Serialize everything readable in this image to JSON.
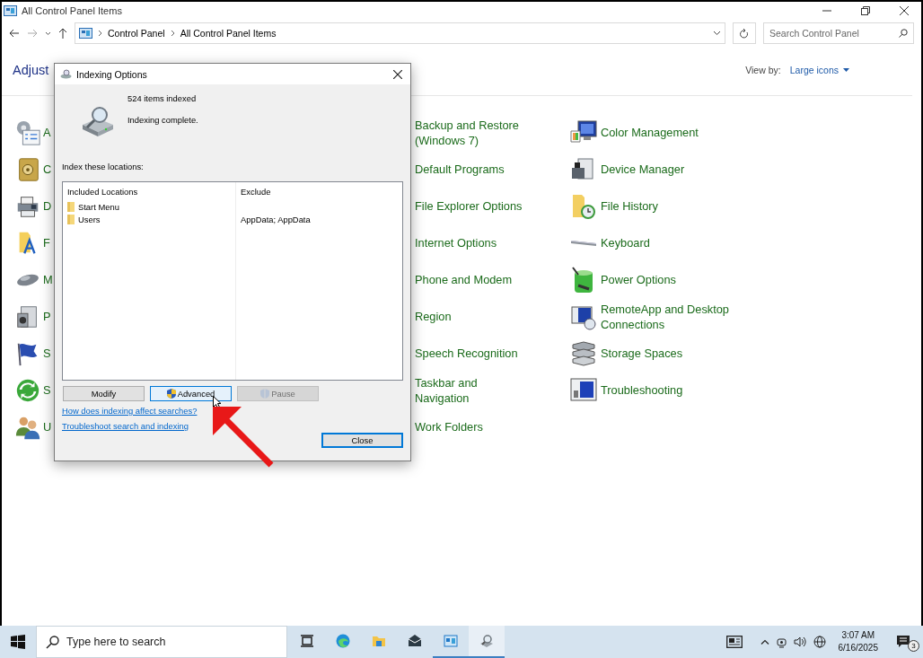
{
  "window": {
    "title": "All Control Panel Items",
    "path": [
      "Control Panel",
      "All Control Panel Items"
    ],
    "search": {
      "placeholder": "Search Control Panel"
    }
  },
  "header": {
    "title": "Adjust",
    "view_by_label": "View by:",
    "view_by_value": "Large icons"
  },
  "columns": [
    {
      "items": [
        {
          "label": "A"
        },
        {
          "label": "C"
        },
        {
          "label": "D"
        },
        {
          "label": "F"
        },
        {
          "label": "M"
        },
        {
          "label": "P"
        },
        {
          "label": "S"
        },
        {
          "label": "S"
        },
        {
          "label": "U"
        }
      ]
    },
    {
      "items": [
        {
          "label": "Backup and Restore (Windows 7)"
        },
        {
          "label": "Default Programs"
        },
        {
          "label": "File Explorer Options"
        },
        {
          "label": "Internet Options"
        },
        {
          "label": "Phone and Modem"
        },
        {
          "label": "Region"
        },
        {
          "label": "Speech Recognition"
        },
        {
          "label": "Taskbar and Navigation"
        },
        {
          "label": "Work Folders"
        }
      ]
    },
    {
      "items": [
        {
          "label": "Color Management"
        },
        {
          "label": "Device Manager"
        },
        {
          "label": "File History"
        },
        {
          "label": "Keyboard"
        },
        {
          "label": "Power Options"
        },
        {
          "label": "RemoteApp and Desktop Connections"
        },
        {
          "label": "Storage Spaces"
        },
        {
          "label": "Troubleshooting"
        }
      ]
    }
  ],
  "dialog": {
    "title": "Indexing Options",
    "count": "524 items indexed",
    "status": "Indexing complete.",
    "locations_label": "Index these locations:",
    "list": {
      "columns": [
        "Included Locations",
        "Exclude"
      ],
      "rows": [
        {
          "location": "Start Menu"
        },
        {
          "location": "Users",
          "exclude": "AppData; AppData"
        }
      ]
    },
    "buttons": [
      {
        "label": "Modify",
        "kind": "plain",
        "focused": false,
        "disabled": false
      },
      {
        "label": "Advanced",
        "kind": "elevated",
        "focused": true,
        "disabled": false
      },
      {
        "label": "Pause",
        "kind": "elevated",
        "focused": false,
        "disabled": true
      }
    ],
    "links": [
      "How does indexing affect searches?",
      "Troubleshoot search and indexing"
    ],
    "close_button": {
      "label": "Close"
    }
  },
  "taskbar": {
    "search_placeholder": "Type here to search",
    "apps": [
      {
        "running": false,
        "selected": false
      },
      {
        "running": false,
        "selected": false
      },
      {
        "running": false,
        "selected": false
      },
      {
        "running": false,
        "selected": false
      },
      {
        "running": true,
        "selected": false
      },
      {
        "running": true,
        "selected": true
      }
    ],
    "clock": {
      "time": "3:07 AM",
      "date": "6/16/2025"
    },
    "notifications": {
      "count": "3"
    }
  }
}
